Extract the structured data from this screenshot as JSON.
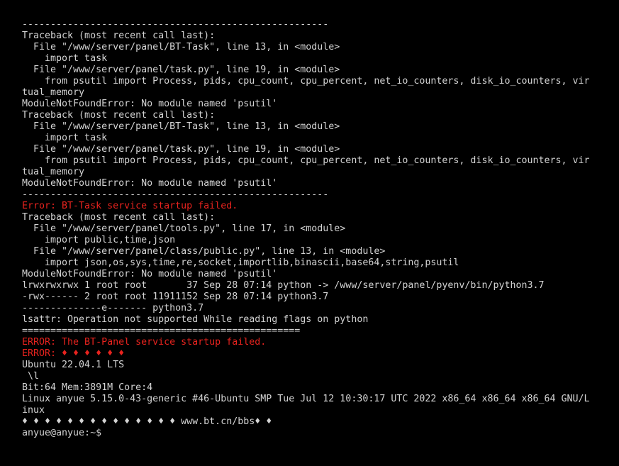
{
  "colors": {
    "foreground": "#d3d3d3",
    "error": "#e8231e",
    "background": "#000000"
  },
  "terminal": {
    "lines": [
      {
        "text": "------------------------------------------------------",
        "style": "normal"
      },
      {
        "text": "Traceback (most recent call last):",
        "style": "normal"
      },
      {
        "text": "  File \"/www/server/panel/BT-Task\", line 13, in <module>",
        "style": "normal"
      },
      {
        "text": "    import task",
        "style": "normal"
      },
      {
        "text": "  File \"/www/server/panel/task.py\", line 19, in <module>",
        "style": "normal"
      },
      {
        "text": "    from psutil import Process, pids, cpu_count, cpu_percent, net_io_counters, disk_io_counters, vir",
        "style": "normal"
      },
      {
        "text": "tual_memory",
        "style": "normal"
      },
      {
        "text": "ModuleNotFoundError: No module named 'psutil'",
        "style": "normal"
      },
      {
        "text": "Traceback (most recent call last):",
        "style": "normal"
      },
      {
        "text": "  File \"/www/server/panel/BT-Task\", line 13, in <module>",
        "style": "normal"
      },
      {
        "text": "    import task",
        "style": "normal"
      },
      {
        "text": "  File \"/www/server/panel/task.py\", line 19, in <module>",
        "style": "normal"
      },
      {
        "text": "    from psutil import Process, pids, cpu_count, cpu_percent, net_io_counters, disk_io_counters, vir",
        "style": "normal"
      },
      {
        "text": "tual_memory",
        "style": "normal"
      },
      {
        "text": "ModuleNotFoundError: No module named 'psutil'",
        "style": "normal"
      },
      {
        "text": "------------------------------------------------------",
        "style": "normal"
      },
      {
        "text": "Error: BT-Task service startup failed.",
        "style": "error"
      },
      {
        "text": "Traceback (most recent call last):",
        "style": "normal"
      },
      {
        "text": "  File \"/www/server/panel/tools.py\", line 17, in <module>",
        "style": "normal"
      },
      {
        "text": "    import public,time,json",
        "style": "normal"
      },
      {
        "text": "  File \"/www/server/panel/class/public.py\", line 13, in <module>",
        "style": "normal"
      },
      {
        "text": "    import json,os,sys,time,re,socket,importlib,binascii,base64,string,psutil",
        "style": "normal"
      },
      {
        "text": "ModuleNotFoundError: No module named 'psutil'",
        "style": "normal"
      },
      {
        "text": "lrwxrwxrwx 1 root root       37 Sep 28 07:14 python -> /www/server/panel/pyenv/bin/python3.7",
        "style": "normal"
      },
      {
        "text": "-rwx------ 2 root root 11911152 Sep 28 07:14 python3.7",
        "style": "normal"
      },
      {
        "text": "--------------e------- python3.7",
        "style": "normal"
      },
      {
        "text": "lsattr: Operation not supported While reading flags on python",
        "style": "normal"
      },
      {
        "text": "=================================================",
        "style": "normal"
      },
      {
        "text": "ERROR: The BT-Panel service startup failed.",
        "style": "error"
      },
      {
        "text": "ERROR: ♦ ♦ ♦ ♦ ♦ ♦",
        "style": "error"
      },
      {
        "text": "Ubuntu 22.04.1 LTS",
        "style": "normal"
      },
      {
        "text": " \\l",
        "style": "normal"
      },
      {
        "text": "Bit:64 Mem:3891M Core:4",
        "style": "normal"
      },
      {
        "text": "Linux anyue 5.15.0-43-generic #46-Ubuntu SMP Tue Jul 12 10:30:17 UTC 2022 x86_64 x86_64 x86_64 GNU/L",
        "style": "normal"
      },
      {
        "text": "inux",
        "style": "normal"
      },
      {
        "text": "♦ ♦ ♦ ♦ ♦ ♦ ♦ ♦ ♦ ♦ ♦ ♦ ♦ ♦ www.bt.cn/bbs♦ ♦",
        "style": "normal"
      },
      {
        "text": "anyue@anyue:~$",
        "style": "prompt"
      }
    ]
  }
}
